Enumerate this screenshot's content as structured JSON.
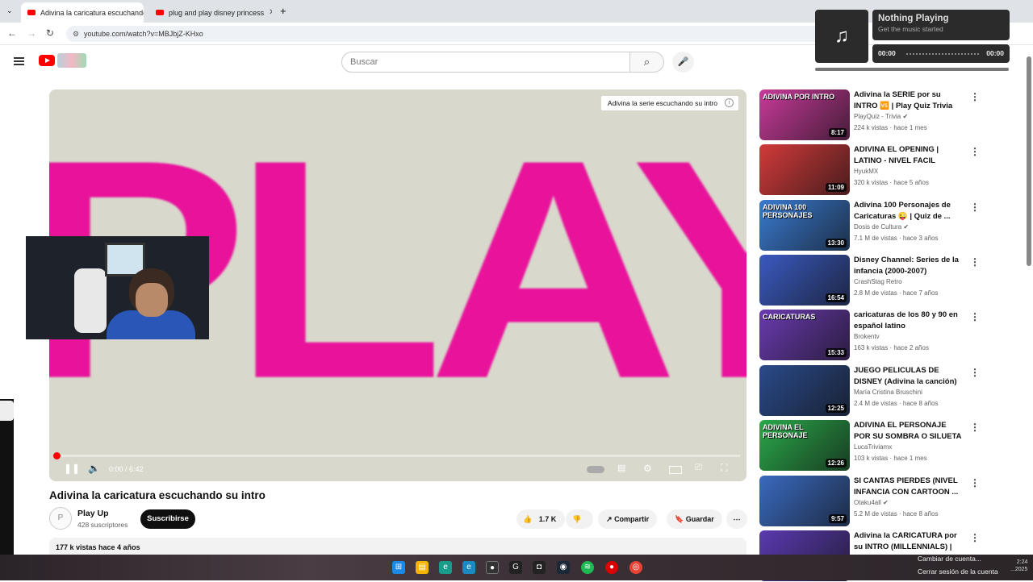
{
  "browser": {
    "tabs": [
      {
        "label": "Adivina la caricatura escuchando"
      },
      {
        "label": "plug and play disney princess"
      }
    ],
    "url": "youtube.com/watch?v=MBJbjZ-KHxo"
  },
  "youtube": {
    "search_placeholder": "Buscar"
  },
  "player": {
    "frame_text": "PLAY",
    "overlay_title": "Adivina la serie escuchando su intro",
    "overlay_info": "i",
    "time": "0:00 / 6:42"
  },
  "video": {
    "title": "Adivina la caricatura escuchando su intro",
    "channel": "Play Up",
    "subscribers": "428 suscriptores",
    "subscribe_label": "Suscribirse",
    "likes": "1.7 K",
    "share_label": "Compartir",
    "save_label": "Guardar",
    "views_date": "177 k vistas  hace 4 años"
  },
  "recommendations": [
    {
      "title": "Adivina la SERIE por su INTRO 🆚 | Play Quiz Trivia",
      "channel": "PlayQuiz - Trivia",
      "verified": true,
      "meta": "224 k vistas · hace 1 mes",
      "duration": "8:17",
      "thumb_label": "ADIVINA POR INTRO",
      "color": "#c83a9a"
    },
    {
      "title": "ADIVINA EL OPENING | LATINO - NIVEL FACIL",
      "channel": "HyukMX",
      "verified": false,
      "meta": "320 k vistas · hace 5 años",
      "duration": "11:09",
      "thumb_label": "",
      "color": "#d23a3a"
    },
    {
      "title": "Adivina 100 Personajes de Caricaturas 😜 | Quiz de ...",
      "channel": "Dosis de Cultura",
      "verified": true,
      "meta": "7.1 M de vistas · hace 3 años",
      "duration": "13:30",
      "thumb_label": "ADIVINA 100 PERSONAJES",
      "color": "#3a7ad0"
    },
    {
      "title": "Disney Channel: Series de la infancia (2000-2007)",
      "channel": "CrashStag Retro",
      "verified": false,
      "meta": "2.8 M de vistas · hace 7 años",
      "duration": "16:54",
      "thumb_label": "",
      "color": "#3a5ac0"
    },
    {
      "title": "caricaturas de los 80 y 90 en español latino",
      "channel": "Brokentv",
      "verified": false,
      "meta": "163 k vistas · hace 2 años",
      "duration": "15:33",
      "thumb_label": "CARICATURAS",
      "color": "#6a3ab0"
    },
    {
      "title": "JUEGO PELICULAS DE DISNEY (Adivina la canción) II",
      "channel": "María Cristina Bruschini",
      "verified": false,
      "meta": "2.4 M de vistas · hace 8 años",
      "duration": "12:25",
      "thumb_label": "",
      "color": "#2a4a8a"
    },
    {
      "title": "ADIVINA EL PERSONAJE POR SU SOMBRA O SILUETA",
      "channel": "LucaTriviamx",
      "verified": false,
      "meta": "103 k vistas · hace 1 mes",
      "duration": "12:26",
      "thumb_label": "ADIVINA EL PERSONAJE",
      "color": "#2aa84a"
    },
    {
      "title": "SI CANTAS PIERDES (NIVEL INFANCIA CON CARTOON ...",
      "channel": "Otaku4all",
      "verified": true,
      "meta": "5.2 M de vistas · hace 8 años",
      "duration": "9:57",
      "thumb_label": "",
      "color": "#3a6ac0"
    },
    {
      "title": "Adivina la CARICATURA por su INTRO (MILLENNIALS) | QUIZ |...",
      "channel": "",
      "verified": false,
      "meta": "",
      "duration": "",
      "thumb_label": "",
      "color": "#5a3ab0"
    }
  ],
  "music_widget": {
    "title": "Nothing Playing",
    "subtitle": "Get the music started",
    "time_start": "00:00",
    "time_end": "00:00"
  },
  "taskbar": {
    "tray_line1": "Cambiar de cuenta...",
    "tray_line2": "Cerrar sesión de la cuenta",
    "clock_time": "2:24",
    "clock_date": "...2025"
  }
}
